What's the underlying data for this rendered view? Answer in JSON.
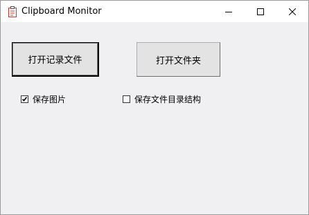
{
  "window": {
    "title": "Clipboard Monitor",
    "app_icon": "clipboard-icon",
    "controls": {
      "minimize_icon": "minimize-icon",
      "maximize_icon": "maximize-icon",
      "close_icon": "close-icon"
    }
  },
  "buttons": {
    "open_log_file": "打开记录文件",
    "open_folder": "打开文件夹"
  },
  "options": {
    "save_images": {
      "label": "保存图片",
      "checked": true
    },
    "save_dir_structure": {
      "label": "保存文件目录结构",
      "checked": false
    }
  },
  "colors": {
    "client_background": "#f0eff2",
    "button_face": "#e3e3e3",
    "icon_accent": "#c0392b"
  }
}
